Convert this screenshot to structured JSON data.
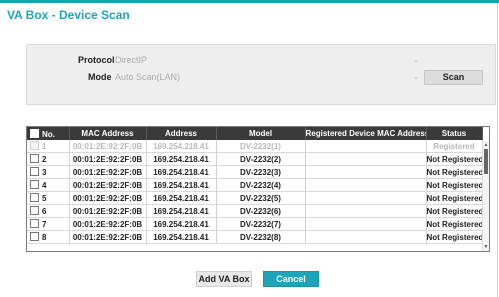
{
  "dialog": {
    "title": "VA Box - Device Scan"
  },
  "form": {
    "protocol_label": "Protocol",
    "protocol_value": "DirectIP",
    "mode_label": "Mode",
    "mode_value": "Auto Scan(LAN)",
    "scan_button": "Scan"
  },
  "table": {
    "columns": [
      "No.",
      "MAC Address",
      "Address",
      "Model",
      "Registered Device MAC Address",
      "Status"
    ],
    "rows": [
      {
        "no": "1",
        "mac": "00:01:2E:92:2F:0B",
        "address": "169.254.218.41",
        "model": "DV-2232(1)",
        "registered_mac": "",
        "status": "Registered",
        "registered": true
      },
      {
        "no": "2",
        "mac": "00:01:2E:92:2F:0B",
        "address": "169.254.218.41",
        "model": "DV-2232(2)",
        "registered_mac": "",
        "status": "Not Registered",
        "registered": false
      },
      {
        "no": "3",
        "mac": "00:01:2E:92:2F:0B",
        "address": "169.254.218.41",
        "model": "DV-2232(3)",
        "registered_mac": "",
        "status": "Not Registered",
        "registered": false
      },
      {
        "no": "4",
        "mac": "00:01:2E:92:2F:0B",
        "address": "169.254.218.41",
        "model": "DV-2232(4)",
        "registered_mac": "",
        "status": "Not Registered",
        "registered": false
      },
      {
        "no": "5",
        "mac": "00:01:2E:92:2F:0B",
        "address": "169.254.218.41",
        "model": "DV-2232(5)",
        "registered_mac": "",
        "status": "Not Registered",
        "registered": false
      },
      {
        "no": "6",
        "mac": "00:01:2E:92:2F:0B",
        "address": "169.254.218.41",
        "model": "DV-2232(6)",
        "registered_mac": "",
        "status": "Not Registered",
        "registered": false
      },
      {
        "no": "7",
        "mac": "00:01:2E:92:2F:0B",
        "address": "169.254.218.41",
        "model": "DV-2232(7)",
        "registered_mac": "",
        "status": "Not Registered",
        "registered": false
      },
      {
        "no": "8",
        "mac": "00:01:2E:92:2F:0B",
        "address": "169.254.218.41",
        "model": "DV-2232(8)",
        "registered_mac": "",
        "status": "Not Registered",
        "registered": false
      }
    ]
  },
  "buttons": {
    "add": "Add VA Box",
    "cancel": "Cancel"
  },
  "icons": {
    "scroll_up": "arrow-up-icon",
    "scroll_down": "arrow-down-icon",
    "dropdown": "chevron-down-icon"
  },
  "colors": {
    "accent": "#1ea4b8",
    "header_bg": "#3a3a3a",
    "registered_text": "#b8b8b8"
  }
}
